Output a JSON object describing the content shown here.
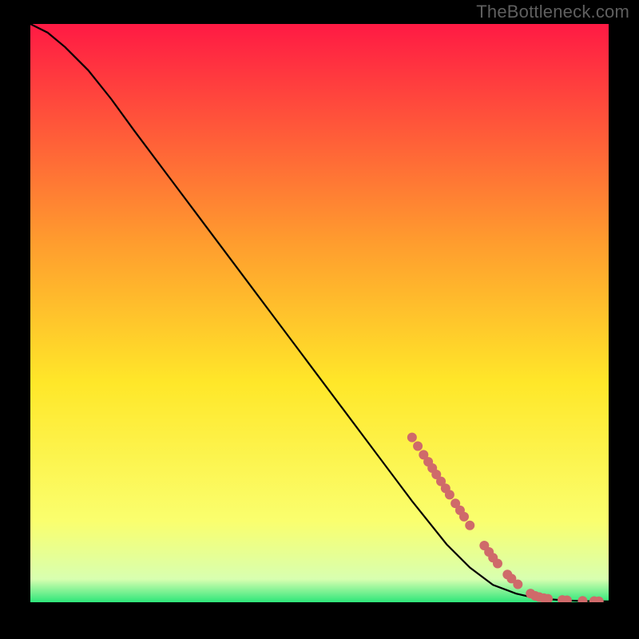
{
  "watermark": "TheBottleneck.com",
  "colors": {
    "page_bg": "#000000",
    "gradient_top": "#ff1a44",
    "gradient_mid1": "#ff9d2e",
    "gradient_mid2": "#ffe729",
    "gradient_mid3": "#faff6e",
    "gradient_bottom": "#2ee67a",
    "curve": "#000000",
    "marker_fill": "#cf6a6a",
    "marker_stroke": "#cf6a6a",
    "watermark": "#5f5f5f"
  },
  "chart_data": {
    "type": "line",
    "title": "",
    "xlabel": "",
    "ylabel": "",
    "xlim": [
      0,
      100
    ],
    "ylim": [
      0,
      100
    ],
    "curve": {
      "x": [
        0,
        3,
        6,
        10,
        14,
        18,
        24,
        30,
        36,
        42,
        48,
        54,
        60,
        66,
        72,
        76,
        80,
        84,
        87,
        90,
        93,
        96,
        100
      ],
      "y": [
        100,
        98.5,
        96,
        92,
        87,
        81.5,
        73.5,
        65.5,
        57.5,
        49.5,
        41.5,
        33.5,
        25.5,
        17.5,
        10,
        6,
        3,
        1.5,
        0.8,
        0.5,
        0.3,
        0.2,
        0.15
      ]
    },
    "markers": [
      {
        "x": 66,
        "y": 28.5
      },
      {
        "x": 67,
        "y": 27
      },
      {
        "x": 68,
        "y": 25.5
      },
      {
        "x": 68.8,
        "y": 24.3
      },
      {
        "x": 69.5,
        "y": 23.2
      },
      {
        "x": 70.2,
        "y": 22.1
      },
      {
        "x": 71,
        "y": 20.9
      },
      {
        "x": 71.8,
        "y": 19.7
      },
      {
        "x": 72.5,
        "y": 18.6
      },
      {
        "x": 73.5,
        "y": 17.1
      },
      {
        "x": 74.3,
        "y": 15.9
      },
      {
        "x": 75,
        "y": 14.8
      },
      {
        "x": 76,
        "y": 13.3
      },
      {
        "x": 78.5,
        "y": 9.8
      },
      {
        "x": 79.3,
        "y": 8.7
      },
      {
        "x": 80,
        "y": 7.7
      },
      {
        "x": 80.8,
        "y": 6.7
      },
      {
        "x": 82.5,
        "y": 4.8
      },
      {
        "x": 83.2,
        "y": 4.1
      },
      {
        "x": 84.3,
        "y": 3.1
      },
      {
        "x": 86.5,
        "y": 1.5
      },
      {
        "x": 87.3,
        "y": 1.1
      },
      {
        "x": 88,
        "y": 0.9
      },
      {
        "x": 88.8,
        "y": 0.7
      },
      {
        "x": 89.5,
        "y": 0.6
      },
      {
        "x": 92,
        "y": 0.4
      },
      {
        "x": 92.8,
        "y": 0.35
      },
      {
        "x": 95.5,
        "y": 0.25
      },
      {
        "x": 97.5,
        "y": 0.2
      },
      {
        "x": 98.3,
        "y": 0.18
      }
    ]
  }
}
